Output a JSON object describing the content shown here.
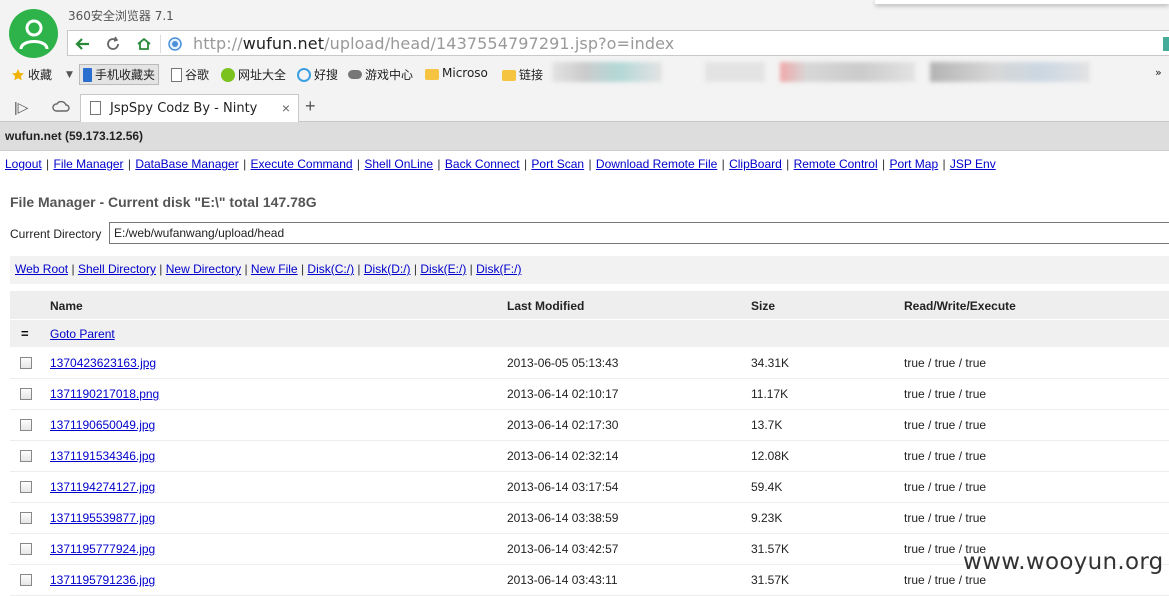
{
  "browser": {
    "app_title": "360安全浏览器 7.1",
    "url_prefix": "http://",
    "url_domain": "wufun.net",
    "url_path": "/upload/head/1437554797291.jsp?o=index",
    "bookmarks": [
      {
        "label": "收藏",
        "icon": "star-icon"
      },
      {
        "label": "手机收藏夹",
        "icon": "phone-icon"
      },
      {
        "label": "谷歌",
        "icon": "page-icon"
      },
      {
        "label": "网址大全",
        "icon": "globe-icon"
      },
      {
        "label": "好搜",
        "icon": "search-icon"
      },
      {
        "label": "游戏中心",
        "icon": "gamepad-icon"
      },
      {
        "label": "Microso",
        "icon": "folder-icon"
      },
      {
        "label": "链接",
        "icon": "folder-icon"
      }
    ],
    "tab": {
      "title": "JspSpy Codz By - Ninty",
      "close": "×"
    },
    "new_tab": "+"
  },
  "page": {
    "host": "wufun.net (59.173.12.56)",
    "menu": [
      "Logout",
      "File Manager",
      "DataBase Manager",
      "Execute Command",
      "Shell OnLine",
      "Back Connect",
      "Port Scan",
      "Download Remote File",
      "ClipBoard",
      "Remote Control",
      "Port Map",
      "JSP Env"
    ],
    "fm_title": "File Manager - Current disk \"E:\\\" total 147.78G",
    "current_dir_label": "Current Directory",
    "current_dir_value": "E:/web/wufanwang/upload/head",
    "subnav": [
      "Web Root",
      "Shell Directory",
      "New Directory",
      "New File",
      "Disk(C:/)",
      "Disk(D:/)",
      "Disk(E:/)",
      "Disk(F:/)"
    ],
    "table": {
      "headers": {
        "name": "Name",
        "modified": "Last Modified",
        "size": "Size",
        "perm": "Read/Write/Execute"
      },
      "parent_icon": "=",
      "parent_label": "Goto Parent",
      "rows": [
        {
          "name": "1370423623163.jpg",
          "modified": "2013-06-05 05:13:43",
          "size": "34.31K",
          "perm": "true / true / true"
        },
        {
          "name": "1371190217018.png",
          "modified": "2013-06-14 02:10:17",
          "size": "11.17K",
          "perm": "true / true / true"
        },
        {
          "name": "1371190650049.jpg",
          "modified": "2013-06-14 02:17:30",
          "size": "13.7K",
          "perm": "true / true / true"
        },
        {
          "name": "1371191534346.jpg",
          "modified": "2013-06-14 02:32:14",
          "size": "12.08K",
          "perm": "true / true / true"
        },
        {
          "name": "1371194274127.jpg",
          "modified": "2013-06-14 03:17:54",
          "size": "59.4K",
          "perm": "true / true / true"
        },
        {
          "name": "1371195539877.jpg",
          "modified": "2013-06-14 03:38:59",
          "size": "9.23K",
          "perm": "true / true / true"
        },
        {
          "name": "1371195777924.jpg",
          "modified": "2013-06-14 03:42:57",
          "size": "31.57K",
          "perm": "true / true / true"
        },
        {
          "name": "1371195791236.jpg",
          "modified": "2013-06-14 03:43:11",
          "size": "31.57K",
          "perm": "true / true / true"
        }
      ]
    }
  },
  "watermark": "www.wooyun.org",
  "colors": {
    "link": "#0000cc",
    "logo": "#2eb24a",
    "header_bg": "#dddddd"
  }
}
